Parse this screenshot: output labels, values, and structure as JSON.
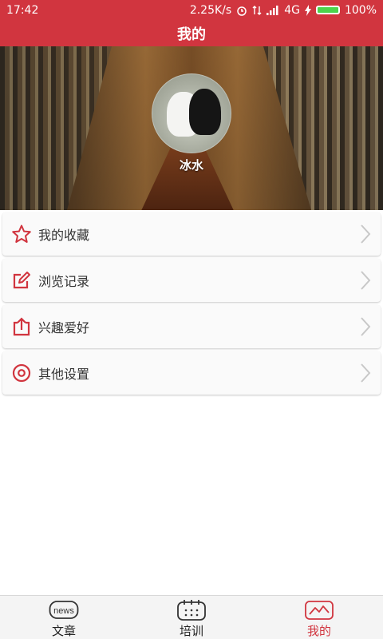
{
  "status_bar": {
    "time": "17:42",
    "speed": "2.25K/s",
    "network": "4G",
    "battery": "100%",
    "battery_level": 1.0
  },
  "header": {
    "title": "我的"
  },
  "profile": {
    "username": "冰水"
  },
  "menu": {
    "items": [
      {
        "label": "我的收藏",
        "icon": "star-icon"
      },
      {
        "label": "浏览记录",
        "icon": "edit-icon"
      },
      {
        "label": "兴趣爱好",
        "icon": "share-icon"
      },
      {
        "label": "其他设置",
        "icon": "settings-icon"
      }
    ]
  },
  "tabbar": {
    "tabs": [
      {
        "label": "文章",
        "icon_text": "news",
        "icon": "news-icon",
        "active": false
      },
      {
        "label": "培训",
        "icon": "calendar-icon",
        "active": false
      },
      {
        "label": "我的",
        "icon": "profile-chart-icon",
        "active": true
      }
    ]
  },
  "colors": {
    "accent": "#d1353f",
    "text": "#333333",
    "tab_bg": "#f4f4f4"
  }
}
